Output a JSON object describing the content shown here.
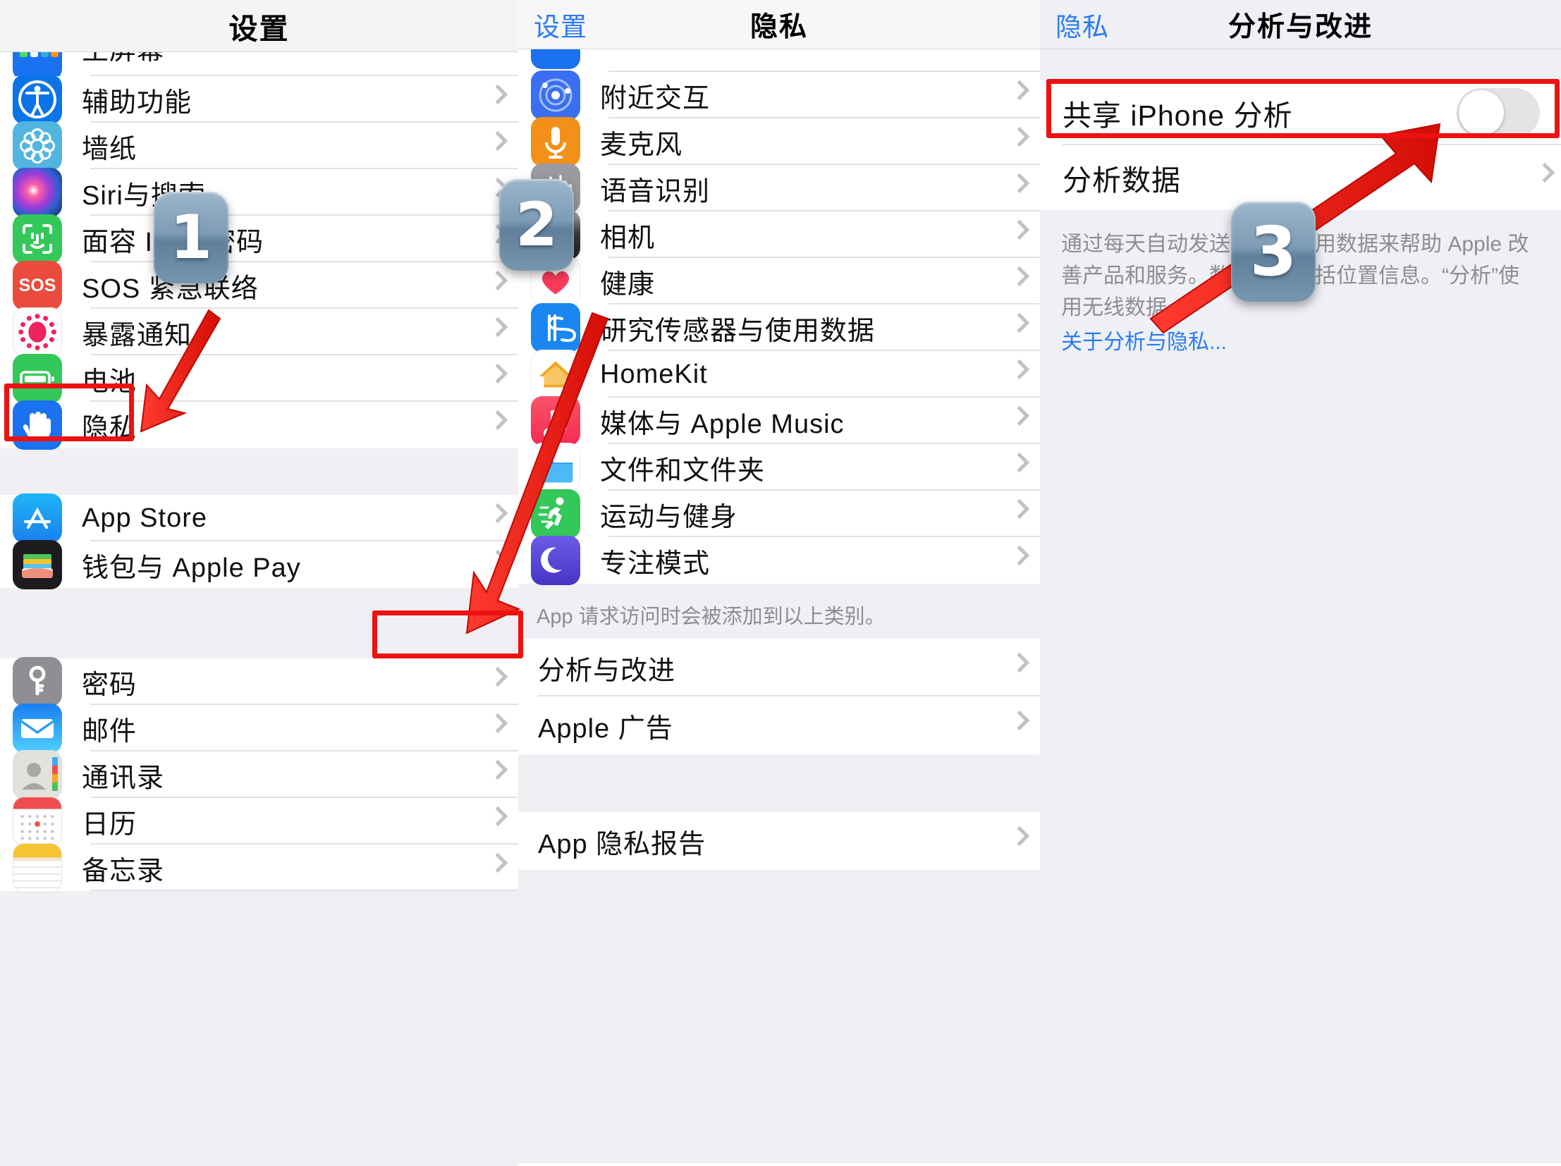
{
  "panels": {
    "settings": {
      "nav_title": "设置",
      "partial_top_item": "主屏幕",
      "groups": [
        {
          "items": [
            {
              "label": "辅助功能",
              "icon": "accessibility-icon"
            },
            {
              "label": "墙纸",
              "icon": "wallpaper-icon"
            },
            {
              "label": "Siri与搜索",
              "icon": "siri-icon"
            },
            {
              "label": "面容 ID 与密码",
              "icon": "faceid-icon"
            },
            {
              "label": "SOS 紧急联络",
              "icon": "sos-icon"
            },
            {
              "label": "暴露通知",
              "icon": "exposure-notification-icon"
            },
            {
              "label": "电池",
              "icon": "battery-icon"
            },
            {
              "label": "隐私",
              "icon": "privacy-hand-icon"
            }
          ]
        },
        {
          "items": [
            {
              "label": "App Store",
              "icon": "appstore-icon"
            },
            {
              "label": "钱包与 Apple Pay",
              "icon": "wallet-icon"
            }
          ]
        },
        {
          "items": [
            {
              "label": "密码",
              "icon": "passwords-key-icon"
            },
            {
              "label": "邮件",
              "icon": "mail-icon"
            },
            {
              "label": "通讯录",
              "icon": "contacts-icon"
            },
            {
              "label": "日历",
              "icon": "calendar-icon"
            },
            {
              "label": "备忘录",
              "icon": "notes-icon"
            }
          ]
        }
      ]
    },
    "privacy": {
      "nav_back": "设置",
      "nav_title": "隐私",
      "groups": [
        {
          "items": [
            {
              "label": "附近交互",
              "icon": "nearby-interactions-icon"
            },
            {
              "label": "麦克风",
              "icon": "microphone-icon"
            },
            {
              "label": "语音识别",
              "icon": "speech-recognition-icon"
            },
            {
              "label": "相机",
              "icon": "camera-icon"
            },
            {
              "label": "健康",
              "icon": "health-heart-icon"
            },
            {
              "label": "研究传感器与使用数据",
              "icon": "research-sensor-icon"
            },
            {
              "label": "HomeKit",
              "icon": "homekit-icon"
            },
            {
              "label": "媒体与 Apple Music",
              "icon": "music-icon"
            },
            {
              "label": "文件和文件夹",
              "icon": "files-folder-icon"
            },
            {
              "label": "运动与健身",
              "icon": "fitness-run-icon"
            },
            {
              "label": "专注模式",
              "icon": "focus-moon-icon"
            }
          ]
        }
      ],
      "footnote": "App 请求访问时会被添加到以上类别。",
      "group2": [
        {
          "label": "分析与改进"
        },
        {
          "label": "Apple 广告"
        }
      ],
      "group3": [
        {
          "label": "App 隐私报告"
        }
      ]
    },
    "analytics": {
      "nav_back": "隐私",
      "nav_title": "分析与改进",
      "rows": [
        {
          "label": "共享 iPhone 分析",
          "control": "toggle",
          "toggle_on": false
        },
        {
          "label": "分析数据",
          "control": "chevron"
        }
      ],
      "description": "通过每天自动发送诊断和使用数据来帮助 Apple 改善产品和服务。数据可能包括位置信息。“分析”使用无线数据。",
      "link": "关于分析与隐私..."
    }
  },
  "annotations": {
    "steps": [
      {
        "number": "1"
      },
      {
        "number": "2"
      },
      {
        "number": "3"
      }
    ],
    "highlight_color": "#ee1111",
    "arrow_color": "#e8170f"
  }
}
